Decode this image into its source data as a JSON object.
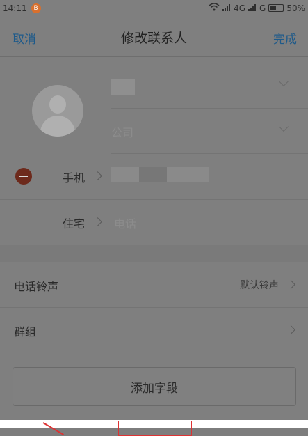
{
  "status_bar": {
    "time": "14:11",
    "notif_badge": "B",
    "network": "4G",
    "carrier_g": "G",
    "battery_percent": "50%",
    "battery_level": 0.5
  },
  "nav": {
    "cancel": "取消",
    "title": "修改联系人",
    "done": "完成"
  },
  "contact": {
    "company_placeholder": "公司",
    "phone_label": "手机",
    "home_label": "住宅",
    "home_placeholder": "电话"
  },
  "settings": {
    "ringtone_label": "电话铃声",
    "ringtone_value": "默认铃声",
    "group_label": "群组"
  },
  "add_field": "添加字段",
  "icons": [
    "wifi-icon",
    "signal-icon",
    "battery-icon",
    "avatar-icon",
    "chevron-down-icon",
    "chevron-right-icon",
    "remove-icon"
  ]
}
